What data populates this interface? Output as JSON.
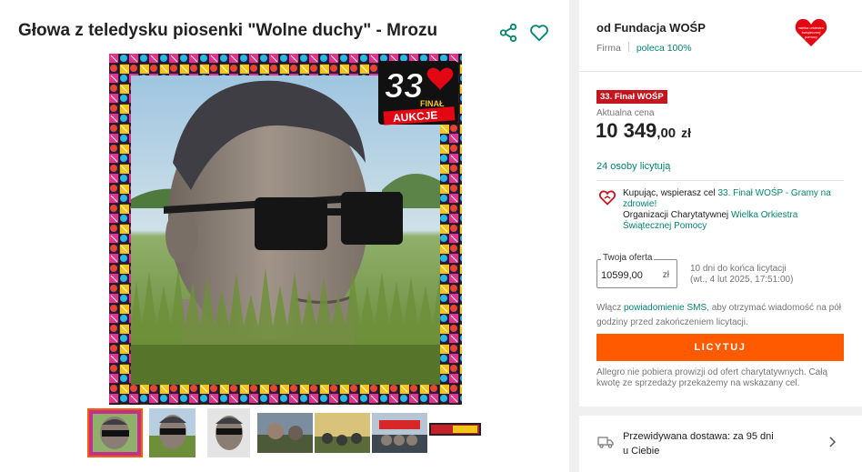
{
  "product": {
    "title": "Głowa z teledysku piosenki \"Wolne duchy\" - Mrozu",
    "badge": {
      "number": "33",
      "line1": "FINAŁ",
      "line2": "AUKCJE",
      "heart_text": "wielka orkiestra świątecznej pomocy"
    },
    "thumbnail_count": 7
  },
  "seller": {
    "name": "od Fundacja WOŚP",
    "type": "Firma",
    "recommendation": "poleca 100%",
    "logo_text": "wielka orkiestra świątecznej pomocy"
  },
  "auction": {
    "final_badge": "33. Finał WOŚP",
    "price_label": "Aktualna cena",
    "price_int": "10 349",
    "price_dec": ",00",
    "currency": "zł",
    "bidders": "24 osoby licytują"
  },
  "charity": {
    "prefix": "Kupując, wspierasz cel ",
    "goal_link": "33. Finał WOŚP - Gramy na zdrowie!",
    "org_prefix": "Organizacji Charytatywnej ",
    "org_link": "Wielka Orkiestra Świątecznej Pomocy"
  },
  "offer": {
    "label": "Twoja oferta",
    "value": "10599,00",
    "currency": "zł",
    "deadline_line1": "10 dni do końca licytacji",
    "deadline_line2": "(wt., 4 lut 2025, 17:51:00)"
  },
  "sms": {
    "prefix": "Włącz ",
    "link": "powiadomienie SMS",
    "suffix": ", aby otrzymać wiadomość na pół godziny przed zakończeniem licytacji."
  },
  "bid_button": "LICYTUJ",
  "fee_note": "Allegro nie pobiera prowizji od ofert charytatywnych. Całą kwotę ze sprzedaży przekażemy na wskazany cel.",
  "delivery": {
    "line1": "Przewidywana dostawa: za 95 dni",
    "line2": "u Ciebie"
  },
  "colors": {
    "accent": "#008673",
    "button": "#ff5a00",
    "badge_red": "#c4161c"
  },
  "icons": [
    "share-icon",
    "heart-icon",
    "wosp-heart-logo",
    "charity-heart-icon",
    "truck-icon",
    "chevron-right-icon"
  ]
}
